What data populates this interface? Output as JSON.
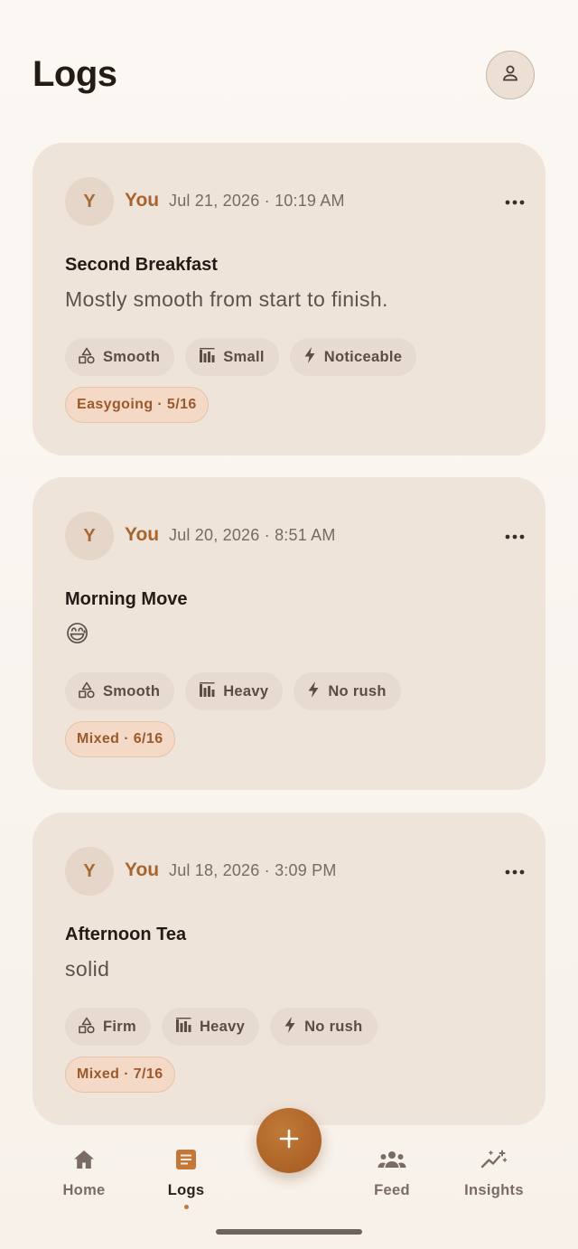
{
  "header": {
    "title": "Logs",
    "profile_icon": "user-icon"
  },
  "entries": [
    {
      "avatar_initial": "Y",
      "author": "You",
      "timestamp": "Jul 21, 2026 · 10:19 AM",
      "title": "Second Breakfast",
      "note": "Mostly smooth from start to finish.",
      "chips": [
        {
          "icon": "shapes-icon",
          "label": "Smooth"
        },
        {
          "icon": "bars-icon",
          "label": "Small"
        },
        {
          "icon": "bolt-icon",
          "label": "Noticeable"
        }
      ],
      "mood": "Easygoing · 5/16"
    },
    {
      "avatar_initial": "Y",
      "author": "You",
      "timestamp": "Jul 20, 2026 · 8:51 AM",
      "title": "Morning Move",
      "note": "😅",
      "chips": [
        {
          "icon": "shapes-icon",
          "label": "Smooth"
        },
        {
          "icon": "bars-icon",
          "label": "Heavy"
        },
        {
          "icon": "bolt-icon",
          "label": "No rush"
        }
      ],
      "mood": "Mixed · 6/16"
    },
    {
      "avatar_initial": "Y",
      "author": "You",
      "timestamp": "Jul 18, 2026 · 3:09 PM",
      "title": "Afternoon Tea",
      "note": "solid",
      "chips": [
        {
          "icon": "shapes-icon",
          "label": "Firm"
        },
        {
          "icon": "bars-icon",
          "label": "Heavy"
        },
        {
          "icon": "bolt-icon",
          "label": "No rush"
        }
      ],
      "mood": "Mixed · 7/16"
    }
  ],
  "fab": {
    "icon": "plus-icon"
  },
  "nav": {
    "items": [
      {
        "label": "Home",
        "icon": "home-icon"
      },
      {
        "label": "Logs",
        "icon": "document-icon",
        "active": true
      },
      {
        "label": "Feed",
        "icon": "people-icon"
      },
      {
        "label": "Insights",
        "icon": "trend-icon"
      }
    ]
  },
  "colors": {
    "accent": "#a8642e",
    "card": "#efe4da",
    "chip": "#e7dbd1",
    "badge": "#f3d9c6"
  }
}
